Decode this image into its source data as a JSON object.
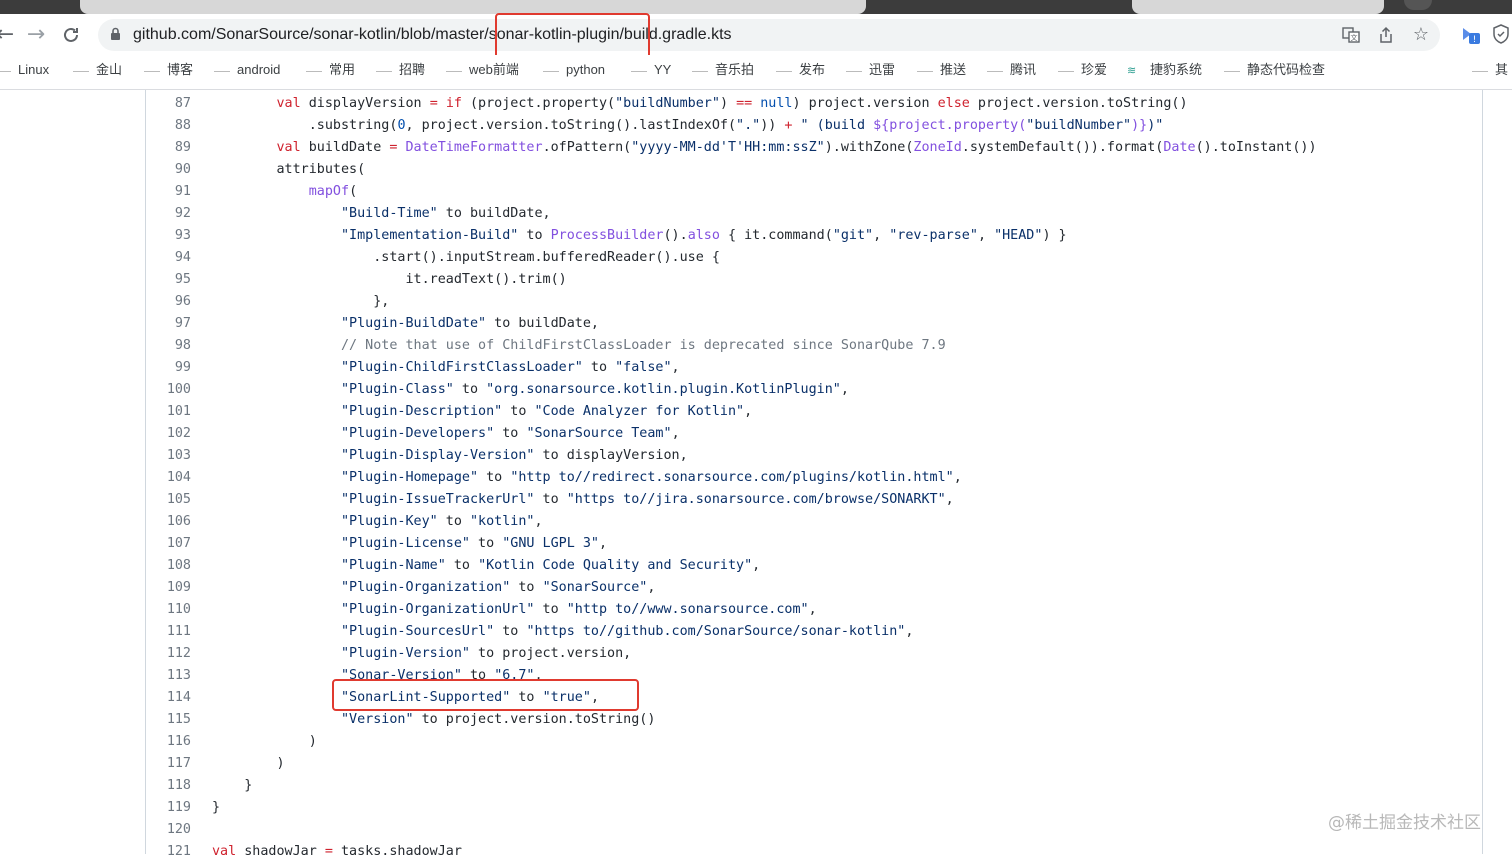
{
  "browser": {
    "url_host": "github.com",
    "url_path": "/SonarSource/sonar-kotlin/blob/master/sonar-kotlin-plugin/build.gradle.kts"
  },
  "bookmarks": [
    {
      "label": "Linux"
    },
    {
      "label": "金山"
    },
    {
      "label": "博客"
    },
    {
      "label": "android"
    },
    {
      "label": "常用"
    },
    {
      "label": "招聘"
    },
    {
      "label": "web前端"
    },
    {
      "label": "python"
    },
    {
      "label": "YY"
    },
    {
      "label": "音乐拍"
    },
    {
      "label": "发布"
    },
    {
      "label": "迅雷"
    },
    {
      "label": "推送"
    },
    {
      "label": "腾讯"
    },
    {
      "label": "珍爱"
    },
    {
      "label": "捷豹系统"
    },
    {
      "label": "静态代码检查"
    },
    {
      "label": "其"
    }
  ],
  "code_lines": [
    {
      "n": "87",
      "segs": [
        {
          "t": "        "
        },
        {
          "t": "val",
          "c": "kw"
        },
        {
          "t": " displayVersion "
        },
        {
          "t": "=",
          "c": "kw"
        },
        {
          "t": " "
        },
        {
          "t": "if",
          "c": "kw"
        },
        {
          "t": " (project.property("
        },
        {
          "t": "\"buildNumber\"",
          "c": "str"
        },
        {
          "t": ") "
        },
        {
          "t": "==",
          "c": "kw"
        },
        {
          "t": " "
        },
        {
          "t": "null",
          "c": "num"
        },
        {
          "t": ") project.version "
        },
        {
          "t": "else",
          "c": "kw"
        },
        {
          "t": " project.version.toString()"
        }
      ]
    },
    {
      "n": "88",
      "segs": [
        {
          "t": "            .substring("
        },
        {
          "t": "0",
          "c": "num"
        },
        {
          "t": ", project.version.toString().lastIndexOf("
        },
        {
          "t": "\".\"",
          "c": "str"
        },
        {
          "t": ")) "
        },
        {
          "t": "+",
          "c": "kw"
        },
        {
          "t": " "
        },
        {
          "t": "\" (build ",
          "c": "str"
        },
        {
          "t": "${project.property(",
          "c": "fn"
        },
        {
          "t": "\"buildNumber\"",
          "c": "str"
        },
        {
          "t": ")}",
          "c": "fn"
        },
        {
          "t": ")\"",
          "c": "str"
        }
      ]
    },
    {
      "n": "89",
      "segs": [
        {
          "t": "        "
        },
        {
          "t": "val",
          "c": "kw"
        },
        {
          "t": " buildDate "
        },
        {
          "t": "=",
          "c": "kw"
        },
        {
          "t": " "
        },
        {
          "t": "DateTimeFormatter",
          "c": "fn"
        },
        {
          "t": ".ofPattern("
        },
        {
          "t": "\"yyyy-MM-dd'T'HH:mm:ssZ\"",
          "c": "str"
        },
        {
          "t": ").withZone("
        },
        {
          "t": "ZoneId",
          "c": "fn"
        },
        {
          "t": ".systemDefault()).format("
        },
        {
          "t": "Date",
          "c": "fn"
        },
        {
          "t": "().toInstant())"
        }
      ]
    },
    {
      "n": "90",
      "segs": [
        {
          "t": "        attributes("
        }
      ]
    },
    {
      "n": "91",
      "segs": [
        {
          "t": "            "
        },
        {
          "t": "mapOf",
          "c": "fn"
        },
        {
          "t": "("
        }
      ]
    },
    {
      "n": "92",
      "segs": [
        {
          "t": "                "
        },
        {
          "t": "\"Build-Time\"",
          "c": "str"
        },
        {
          "t": " to buildDate,"
        }
      ]
    },
    {
      "n": "93",
      "segs": [
        {
          "t": "                "
        },
        {
          "t": "\"Implementation-Build\"",
          "c": "str"
        },
        {
          "t": " to "
        },
        {
          "t": "ProcessBuilder",
          "c": "fn"
        },
        {
          "t": "()."
        },
        {
          "t": "also",
          "c": "fn"
        },
        {
          "t": " { it.command("
        },
        {
          "t": "\"git\"",
          "c": "str"
        },
        {
          "t": ", "
        },
        {
          "t": "\"rev-parse\"",
          "c": "str"
        },
        {
          "t": ", "
        },
        {
          "t": "\"HEAD\"",
          "c": "str"
        },
        {
          "t": ") }"
        }
      ]
    },
    {
      "n": "94",
      "segs": [
        {
          "t": "                    .start().inputStream.bufferedReader().use {"
        }
      ]
    },
    {
      "n": "95",
      "segs": [
        {
          "t": "                        it.readText().trim()"
        }
      ]
    },
    {
      "n": "96",
      "segs": [
        {
          "t": "                    },"
        }
      ]
    },
    {
      "n": "97",
      "segs": [
        {
          "t": "                "
        },
        {
          "t": "\"Plugin-BuildDate\"",
          "c": "str"
        },
        {
          "t": " to buildDate,"
        }
      ]
    },
    {
      "n": "98",
      "segs": [
        {
          "t": "                "
        },
        {
          "t": "// Note that use of ChildFirstClassLoader is deprecated since SonarQube 7.9",
          "c": "cmt"
        }
      ]
    },
    {
      "n": "99",
      "segs": [
        {
          "t": "                "
        },
        {
          "t": "\"Plugin-ChildFirstClassLoader\"",
          "c": "str"
        },
        {
          "t": " to "
        },
        {
          "t": "\"false\"",
          "c": "str"
        },
        {
          "t": ","
        }
      ]
    },
    {
      "n": "100",
      "segs": [
        {
          "t": "                "
        },
        {
          "t": "\"Plugin-Class\"",
          "c": "str"
        },
        {
          "t": " to "
        },
        {
          "t": "\"org.sonarsource.kotlin.plugin.KotlinPlugin\"",
          "c": "str"
        },
        {
          "t": ","
        }
      ]
    },
    {
      "n": "101",
      "segs": [
        {
          "t": "                "
        },
        {
          "t": "\"Plugin-Description\"",
          "c": "str"
        },
        {
          "t": " to "
        },
        {
          "t": "\"Code Analyzer for Kotlin\"",
          "c": "str"
        },
        {
          "t": ","
        }
      ]
    },
    {
      "n": "102",
      "segs": [
        {
          "t": "                "
        },
        {
          "t": "\"Plugin-Developers\"",
          "c": "str"
        },
        {
          "t": " to "
        },
        {
          "t": "\"SonarSource Team\"",
          "c": "str"
        },
        {
          "t": ","
        }
      ]
    },
    {
      "n": "103",
      "segs": [
        {
          "t": "                "
        },
        {
          "t": "\"Plugin-Display-Version\"",
          "c": "str"
        },
        {
          "t": " to displayVersion,"
        }
      ]
    },
    {
      "n": "104",
      "segs": [
        {
          "t": "                "
        },
        {
          "t": "\"Plugin-Homepage\"",
          "c": "str"
        },
        {
          "t": " to "
        },
        {
          "t": "\"http to//redirect.sonarsource.com/plugins/kotlin.html\"",
          "c": "str"
        },
        {
          "t": ","
        }
      ]
    },
    {
      "n": "105",
      "segs": [
        {
          "t": "                "
        },
        {
          "t": "\"Plugin-IssueTrackerUrl\"",
          "c": "str"
        },
        {
          "t": " to "
        },
        {
          "t": "\"https to//jira.sonarsource.com/browse/SONARKT\"",
          "c": "str"
        },
        {
          "t": ","
        }
      ]
    },
    {
      "n": "106",
      "segs": [
        {
          "t": "                "
        },
        {
          "t": "\"Plugin-Key\"",
          "c": "str"
        },
        {
          "t": " to "
        },
        {
          "t": "\"kotlin\"",
          "c": "str"
        },
        {
          "t": ","
        }
      ]
    },
    {
      "n": "107",
      "segs": [
        {
          "t": "                "
        },
        {
          "t": "\"Plugin-License\"",
          "c": "str"
        },
        {
          "t": " to "
        },
        {
          "t": "\"GNU LGPL 3\"",
          "c": "str"
        },
        {
          "t": ","
        }
      ]
    },
    {
      "n": "108",
      "segs": [
        {
          "t": "                "
        },
        {
          "t": "\"Plugin-Name\"",
          "c": "str"
        },
        {
          "t": " to "
        },
        {
          "t": "\"Kotlin Code Quality and Security\"",
          "c": "str"
        },
        {
          "t": ","
        }
      ]
    },
    {
      "n": "109",
      "segs": [
        {
          "t": "                "
        },
        {
          "t": "\"Plugin-Organization\"",
          "c": "str"
        },
        {
          "t": " to "
        },
        {
          "t": "\"SonarSource\"",
          "c": "str"
        },
        {
          "t": ","
        }
      ]
    },
    {
      "n": "110",
      "segs": [
        {
          "t": "                "
        },
        {
          "t": "\"Plugin-OrganizationUrl\"",
          "c": "str"
        },
        {
          "t": " to "
        },
        {
          "t": "\"http to//www.sonarsource.com\"",
          "c": "str"
        },
        {
          "t": ","
        }
      ]
    },
    {
      "n": "111",
      "segs": [
        {
          "t": "                "
        },
        {
          "t": "\"Plugin-SourcesUrl\"",
          "c": "str"
        },
        {
          "t": " to "
        },
        {
          "t": "\"https to//github.com/SonarSource/sonar-kotlin\"",
          "c": "str"
        },
        {
          "t": ","
        }
      ]
    },
    {
      "n": "112",
      "segs": [
        {
          "t": "                "
        },
        {
          "t": "\"Plugin-Version\"",
          "c": "str"
        },
        {
          "t": " to project.version,"
        }
      ]
    },
    {
      "n": "113",
      "segs": [
        {
          "t": "                "
        },
        {
          "t": "\"Sonar-Version\"",
          "c": "str"
        },
        {
          "t": " to "
        },
        {
          "t": "\"6.7\"",
          "c": "str"
        },
        {
          "t": ","
        }
      ]
    },
    {
      "n": "114",
      "segs": [
        {
          "t": "                "
        },
        {
          "t": "\"SonarLint-Supported\"",
          "c": "str"
        },
        {
          "t": " to "
        },
        {
          "t": "\"true\"",
          "c": "str"
        },
        {
          "t": ","
        }
      ]
    },
    {
      "n": "115",
      "segs": [
        {
          "t": "                "
        },
        {
          "t": "\"Version\"",
          "c": "str"
        },
        {
          "t": " to project.version.toString()"
        }
      ]
    },
    {
      "n": "116",
      "segs": [
        {
          "t": "            )"
        }
      ]
    },
    {
      "n": "117",
      "segs": [
        {
          "t": "        )"
        }
      ]
    },
    {
      "n": "118",
      "segs": [
        {
          "t": "    }"
        }
      ]
    },
    {
      "n": "119",
      "segs": [
        {
          "t": "}"
        }
      ]
    },
    {
      "n": "120",
      "segs": [
        {
          "t": ""
        }
      ]
    },
    {
      "n": "121",
      "segs": [
        {
          "t": ""
        },
        {
          "t": "val",
          "c": "kw"
        },
        {
          "t": " shadowJar "
        },
        {
          "t": "=",
          "c": "kw"
        },
        {
          "t": " tasks.shadowJar"
        }
      ]
    }
  ],
  "watermark": "@稀土掘金技术社区",
  "colors": {
    "highlight_box": "#e03a2f",
    "keyword": "#cf222e",
    "string": "#0a3069",
    "function": "#8250df",
    "comment": "#6e7781"
  },
  "icons": {
    "back": "arrow-left-icon",
    "forward": "arrow-right-icon",
    "reload": "reload-icon",
    "translate": "translate-icon",
    "share": "share-icon",
    "bookmark_star": "star-icon"
  }
}
